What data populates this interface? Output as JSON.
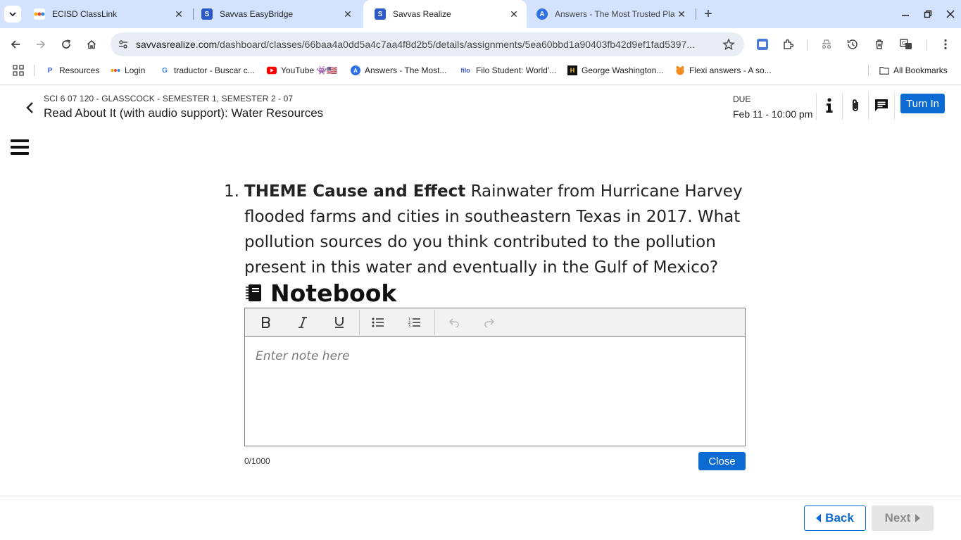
{
  "browser": {
    "tabs": [
      {
        "title": "ECISD ClassLink",
        "favicon": "classlink-icon",
        "active": false
      },
      {
        "title": "Savvas EasyBridge",
        "favicon": "savvas-icon",
        "active": false
      },
      {
        "title": "Savvas Realize",
        "favicon": "savvas-icon",
        "active": true
      },
      {
        "title": "Answers - The Most Trusted Pla",
        "favicon": "answers-icon",
        "active": false
      }
    ],
    "new_tab": "+",
    "url_domain": "savvasrealize.com",
    "url_path": "/dashboard/classes/66baa4a0dd5a4c7aa4f8d2b5/details/assignments/5ea60bbd1a90403fb42d9ef1fad5397...",
    "bookmarks": [
      {
        "label": "Resources"
      },
      {
        "label": "Login"
      },
      {
        "label": "traductor - Buscar c..."
      },
      {
        "label": "YouTube 👾🇺🇸"
      },
      {
        "label": "Answers - The Most..."
      },
      {
        "label": "Filo Student: World'..."
      },
      {
        "label": "George Washington..."
      },
      {
        "label": "Flexi answers - A so..."
      }
    ],
    "all_bookmarks": "All Bookmarks"
  },
  "header": {
    "course": "SCI 6 07 120 - GLASSCOCK - SEMESTER 1, SEMESTER 2 - 07",
    "title": "Read About It (with audio support): Water Resources",
    "due_label": "DUE",
    "due_date": "Feb 11 - 10:00 pm",
    "turn_in": "Turn In"
  },
  "question": {
    "number": "1.",
    "theme": "THEME Cause and Effect",
    "text": " Rainwater from Hurricane Harvey flooded farms and cities in southeastern Texas in 2017. What pollution sources do you think contributed to the pollution present in this water and eventually in the Gulf of Mexico?"
  },
  "notebook": {
    "label": "Notebook",
    "placeholder": "Enter note here",
    "counter": "0/1000",
    "close": "Close"
  },
  "footer": {
    "back": "Back",
    "next": "Next"
  },
  "colors": {
    "primary": "#0b6bd3",
    "tabstrip": "#d3e3fd",
    "omnibox": "#e9eef6"
  }
}
